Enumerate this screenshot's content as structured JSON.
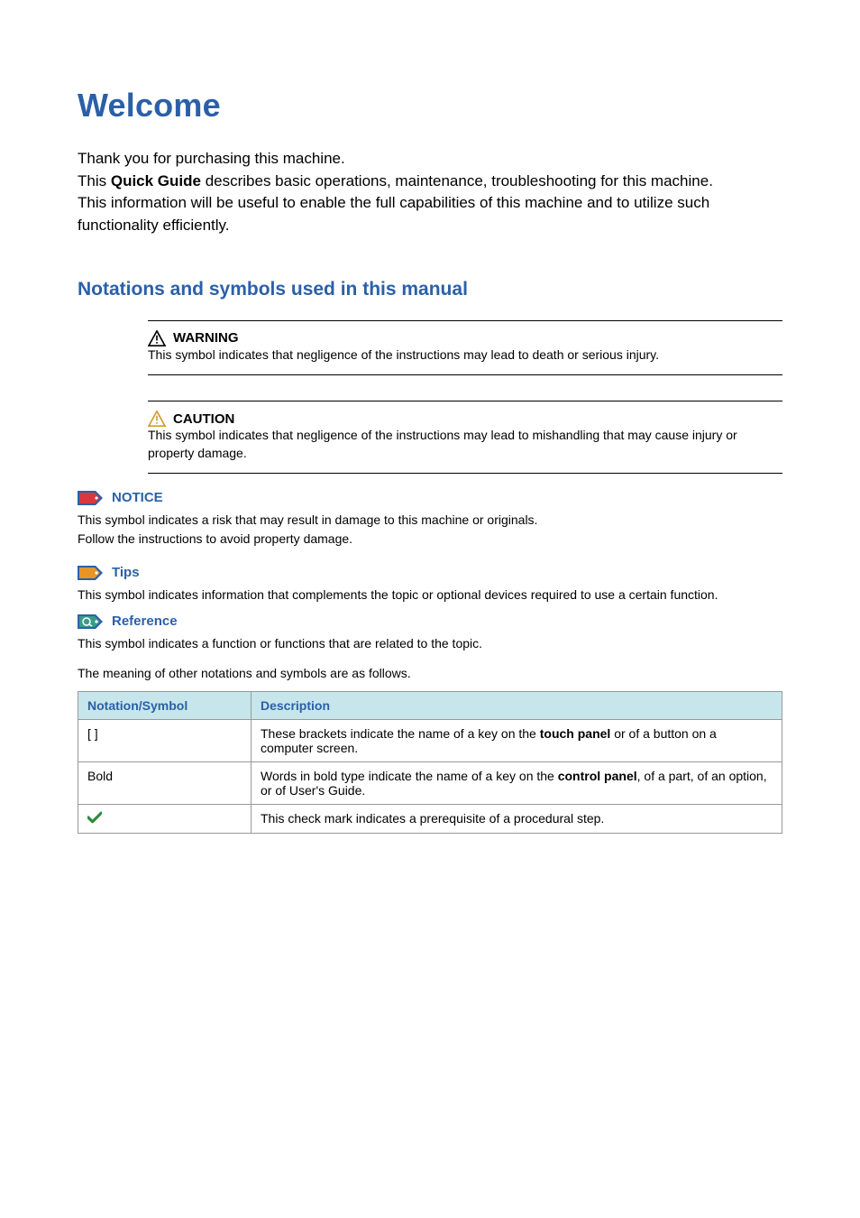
{
  "title": "Welcome",
  "intro": {
    "line1": "Thank you for purchasing this machine.",
    "line2a": "This ",
    "line2b": "Quick Guide",
    "line2c": " describes basic operations, maintenance, troubleshooting for this machine.",
    "line3": "This information will be useful to enable the full capabilities of this machine and to utilize such functionality efficiently."
  },
  "section_heading": "Notations and symbols used in this manual",
  "warning": {
    "label": "WARNING",
    "body": "This symbol indicates that negligence of the instructions may lead to death or serious injury."
  },
  "caution": {
    "label": "CAUTION",
    "body": "This symbol indicates that negligence of the instructions may lead to mishandling that may cause injury or property damage."
  },
  "notice": {
    "label": "NOTICE",
    "body1": "This symbol indicates a risk that may result in damage to this machine or originals.",
    "body2": "Follow the instructions to avoid property damage."
  },
  "tips": {
    "label": "Tips",
    "body": "This symbol indicates information that complements the topic or optional devices required to use a certain function."
  },
  "reference": {
    "label": "Reference",
    "body": "This symbol indicates a function or functions that are related to the topic."
  },
  "table_lead": "The meaning of other notations and symbols are as follows.",
  "table": {
    "header_a": "Notation/Symbol",
    "header_b": "Description",
    "rows": [
      {
        "a": "[ ]",
        "b_pre": "These brackets indicate the name of a key on the ",
        "b_bold": "touch panel",
        "b_post": " or of a button on a computer screen."
      },
      {
        "a": "Bold",
        "b_pre": "Words in bold type indicate the name of a key on the ",
        "b_bold": "control panel",
        "b_post": ", of a part, of an option, or of User's Guide."
      },
      {
        "a": "",
        "b_pre": "This check mark indicates a prerequisite of a procedural step.",
        "b_bold": "",
        "b_post": ""
      }
    ]
  }
}
